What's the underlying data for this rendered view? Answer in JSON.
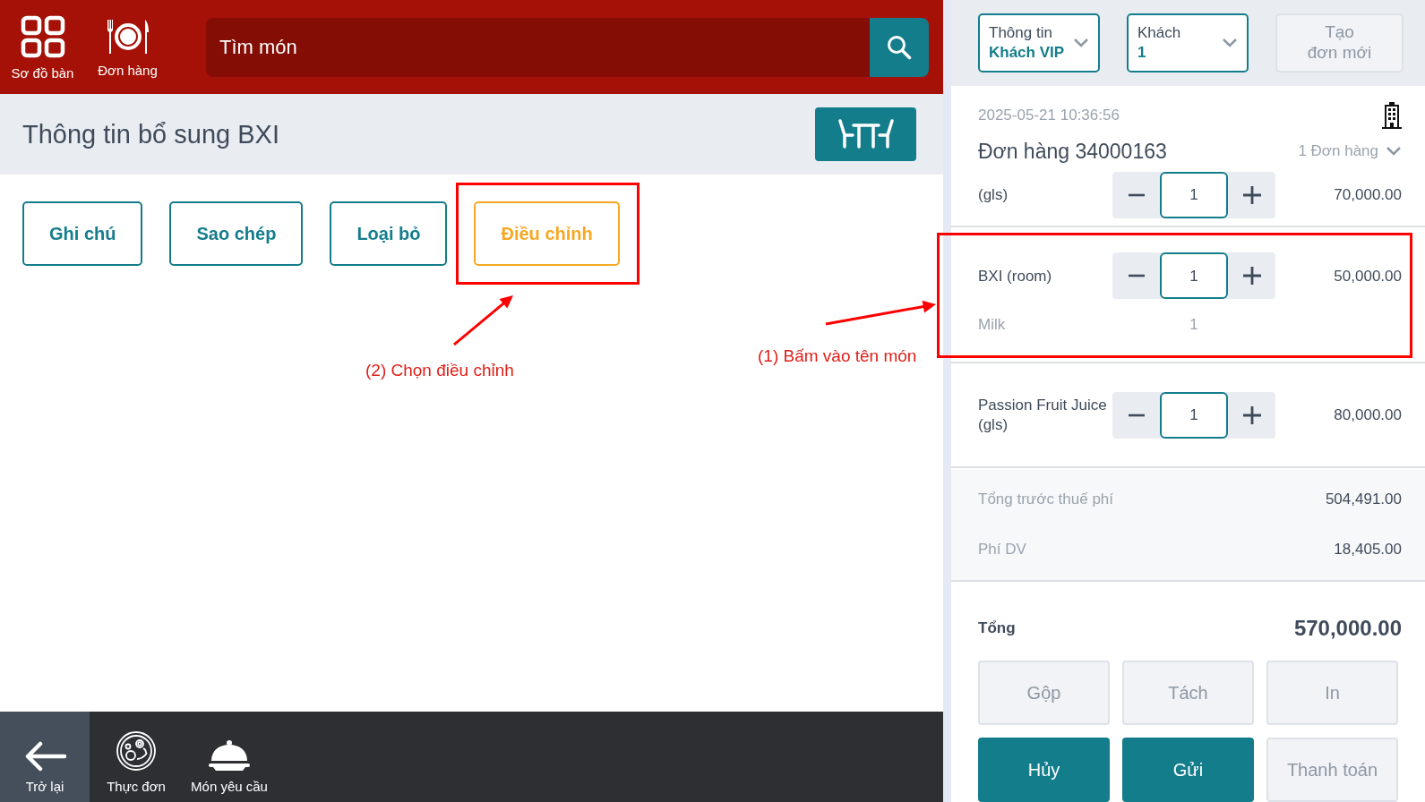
{
  "top_nav": [
    {
      "label": "Sơ đồ bàn",
      "kind": "tables"
    },
    {
      "label": "Đơn hàng",
      "kind": "orders"
    }
  ],
  "search": {
    "placeholder": "Tìm món"
  },
  "section": {
    "title": "Thông tin bổ sung BXI"
  },
  "actions": [
    {
      "label": "Ghi chú",
      "selected": false,
      "highlighted": false
    },
    {
      "label": "Sao chép",
      "selected": false,
      "highlighted": false
    },
    {
      "label": "Loại bỏ",
      "selected": false,
      "highlighted": false
    },
    {
      "label": "Điều chỉnh",
      "selected": true,
      "highlighted": true
    }
  ],
  "annotations": [
    {
      "text": "(2) Chọn điều chỉnh",
      "kind": "action"
    },
    {
      "text": "(1) Bấm vào tên món",
      "kind": "item"
    }
  ],
  "bottom_nav": [
    {
      "label": "Trở lại",
      "kind": "back",
      "selected": true
    },
    {
      "label": "Thực đơn",
      "kind": "menu",
      "selected": false
    },
    {
      "label": "Món yêu cầu",
      "kind": "request",
      "selected": false
    }
  ],
  "order_panel": {
    "selectors": [
      {
        "label": "Thông tin",
        "value": "Khách VIP"
      },
      {
        "label": "Khách",
        "value": "1"
      }
    ],
    "new_order": {
      "label": "Tạo\nđơn mới",
      "disabled": true
    },
    "datetime": "2025-05-21 10:36:56",
    "title": "Đơn hàng 34000163",
    "count": "1 Đơn hàng",
    "items": [
      {
        "name": "(gls)",
        "qty": "1",
        "price": "70,000.00",
        "partial": true,
        "highlighted": false
      },
      {
        "name": "BXI (room)",
        "qty": "1",
        "price": "50,000.00",
        "partial": false,
        "highlighted": true,
        "modifiers": [
          {
            "name": "Milk",
            "qty": "1"
          }
        ]
      },
      {
        "name": "Passion Fruit Juice (gls)",
        "qty": "1",
        "price": "80,000.00",
        "partial": false,
        "highlighted": false
      }
    ],
    "subtotals": [
      {
        "label": "Tổng trước thuế phí",
        "value": "504,491.00"
      },
      {
        "label": "Phí DV",
        "value": "18,405.00"
      }
    ],
    "total": {
      "label": "Tổng",
      "value": "570,000.00"
    },
    "buttons": [
      {
        "label": "Gộp",
        "disabled": true
      },
      {
        "label": "Tách",
        "disabled": true
      },
      {
        "label": "In",
        "disabled": true
      },
      {
        "label": "Hủy",
        "disabled": false
      },
      {
        "label": "Gửi",
        "disabled": false
      },
      {
        "label": "Thanh toán",
        "disabled": true
      }
    ]
  }
}
